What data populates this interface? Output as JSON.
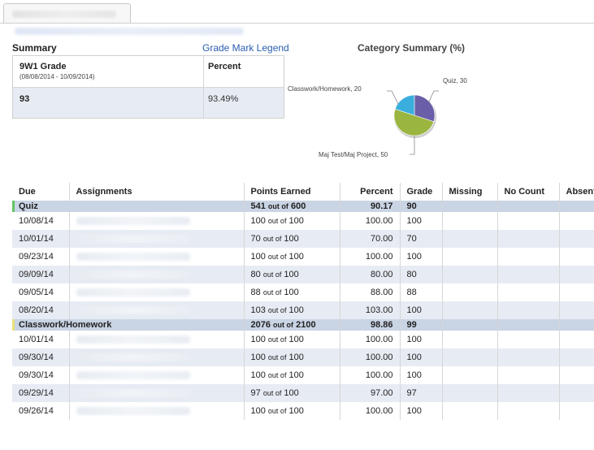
{
  "summary": {
    "title": "Summary",
    "legend_link": "Grade Mark Legend",
    "grade_title": "9W1 Grade",
    "grade_dates": "(08/08/2014 - 10/09/2014)",
    "percent_header": "Percent",
    "grade_value": "93",
    "percent_value": "93.49%"
  },
  "category_summary": {
    "title": "Category Summary (%)",
    "slices": [
      {
        "label": "Quiz, 30",
        "value": 30,
        "color": "#6b5ea8"
      },
      {
        "label": "Maj Test/Maj Project, 50",
        "value": 50,
        "color": "#9ab540"
      },
      {
        "label": "Classwork/Homework, 20",
        "value": 20,
        "color": "#3aaedc"
      }
    ]
  },
  "table": {
    "headers": [
      "Due",
      "Assignments",
      "Points Earned",
      "Percent",
      "Grade",
      "Missing",
      "No Count",
      "Absent"
    ],
    "groups": [
      {
        "name": "Quiz",
        "bar_color": "#62c462",
        "points": "541",
        "total": "600",
        "percent": "90.17",
        "grade": "90",
        "rows": [
          {
            "due": "10/08/14",
            "points": "100",
            "total": "100",
            "percent": "100.00",
            "grade": "100"
          },
          {
            "due": "10/01/14",
            "points": "70",
            "total": "100",
            "percent": "70.00",
            "grade": "70"
          },
          {
            "due": "09/23/14",
            "points": "100",
            "total": "100",
            "percent": "100.00",
            "grade": "100"
          },
          {
            "due": "09/09/14",
            "points": "80",
            "total": "100",
            "percent": "80.00",
            "grade": "80"
          },
          {
            "due": "09/05/14",
            "points": "88",
            "total": "100",
            "percent": "88.00",
            "grade": "88"
          },
          {
            "due": "08/20/14",
            "points": "103",
            "total": "100",
            "percent": "103.00",
            "grade": "100"
          }
        ]
      },
      {
        "name": "Classwork/Homework",
        "bar_color": "#e8e07a",
        "points": "2076",
        "total": "2100",
        "percent": "98.86",
        "grade": "99",
        "rows": [
          {
            "due": "10/01/14",
            "points": "100",
            "total": "100",
            "percent": "100.00",
            "grade": "100"
          },
          {
            "due": "09/30/14",
            "points": "100",
            "total": "100",
            "percent": "100.00",
            "grade": "100"
          },
          {
            "due": "09/30/14",
            "points": "100",
            "total": "100",
            "percent": "100.00",
            "grade": "100"
          },
          {
            "due": "09/29/14",
            "points": "97",
            "total": "100",
            "percent": "97.00",
            "grade": "97"
          },
          {
            "due": "09/26/14",
            "points": "100",
            "total": "100",
            "percent": "100.00",
            "grade": "100"
          }
        ]
      }
    ],
    "out_of_word": "out of"
  }
}
